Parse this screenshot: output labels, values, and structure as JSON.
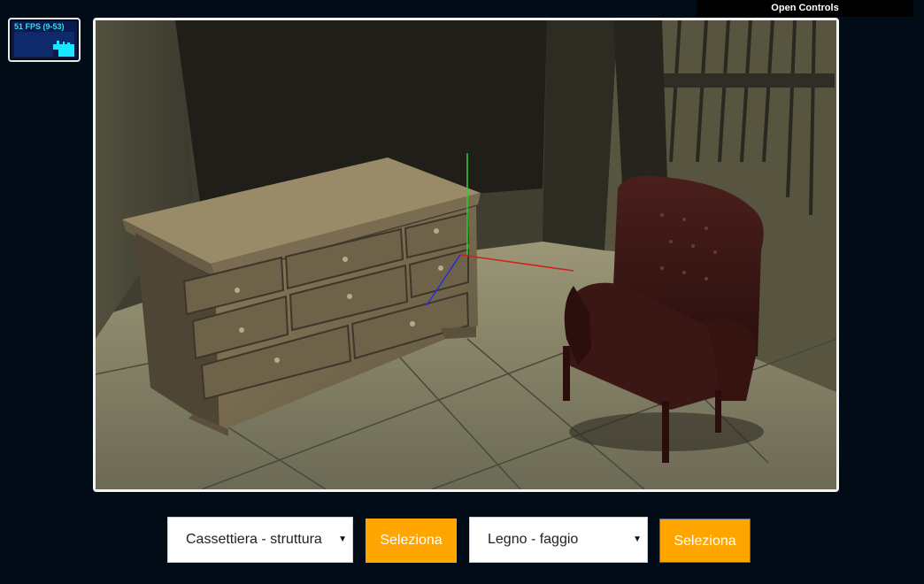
{
  "stats": {
    "fps_label": "51 FPS (9-53)"
  },
  "controls": {
    "open_label": "Open Controls"
  },
  "viewport": {
    "scene": "3d-room-with-dresser-and-armchair"
  },
  "toolbar": {
    "object_select": {
      "value": "Cassettiera - struttura"
    },
    "object_button": "Seleziona",
    "material_select": {
      "value": "Legno - faggio"
    },
    "material_button": "Seleziona",
    "accent_color": "#ffa500"
  },
  "icons": {
    "dropdown": "caret-down-icon"
  }
}
